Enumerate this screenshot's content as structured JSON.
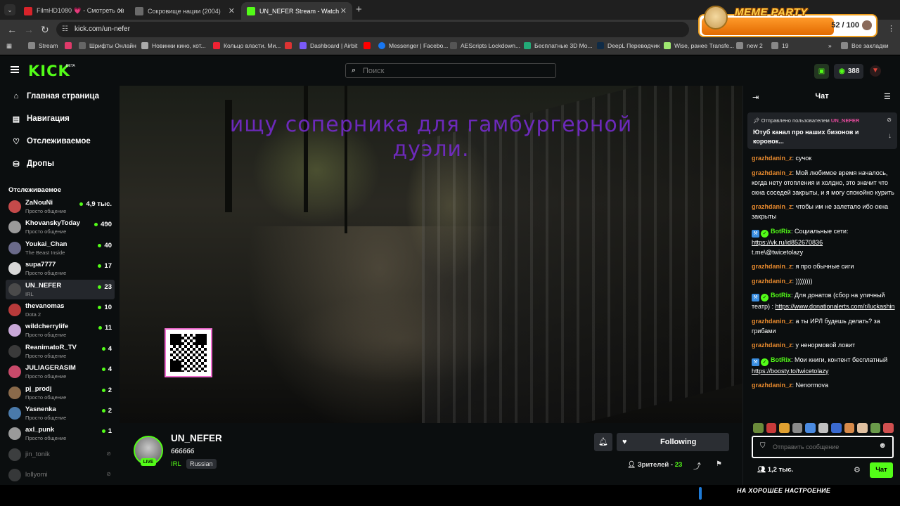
{
  "browser": {
    "tabs": [
      {
        "title": "FilmHD1080 💗 - Смотреть он",
        "favicon_color": "#d8232a",
        "active": false
      },
      {
        "title": "Сокровище нации (2004)",
        "favicon_color": "#6a6a6a",
        "active": false
      },
      {
        "title": "UN_NEFER Stream - Watch",
        "favicon_color": "#53fc18",
        "active": true
      }
    ],
    "url": "kick.com/un-nefer",
    "bookmarks": [
      {
        "label": "Stream",
        "icon_color": "#888"
      },
      {
        "label": "",
        "icon_color": "#e03a6a"
      },
      {
        "label": "Шрифты Онлайн",
        "icon_color": "#666"
      },
      {
        "label": "Новинки кино, кот...",
        "icon_color": "#aaa"
      },
      {
        "label": "Кольцо власти. Ми...",
        "icon_color": "#e23"
      },
      {
        "label": "",
        "icon_color": "#d33"
      },
      {
        "label": "Dashboard | Airbit",
        "icon_color": "#7a5af8"
      },
      {
        "label": "",
        "icon_color": "#f00"
      },
      {
        "label": "Messenger | Facebo...",
        "icon_color": "#1877f2"
      },
      {
        "label": "AEScripts Lockdown...",
        "icon_color": "#555"
      },
      {
        "label": "Бесплатные 3D Mo...",
        "icon_color": "#2a7"
      },
      {
        "label": "DeepL Переводчик",
        "icon_color": "#0f2b46"
      },
      {
        "label": "Wise, ранее Transfe...",
        "icon_color": "#9fe870"
      },
      {
        "label": "new 2",
        "icon_color": "#888"
      },
      {
        "label": "19",
        "icon_color": "#888"
      }
    ],
    "all_bookmarks": "Все закладки"
  },
  "meme_party": {
    "title": "MEME PARTY",
    "progress": "52 / 100",
    "progress_value": 52,
    "progress_max": 100
  },
  "header": {
    "logo": "KICK",
    "logo_badge": "BETA",
    "search_placeholder": "Поиск",
    "kicks_balance": "388"
  },
  "nav": [
    {
      "label": "Главная страница",
      "icon": "home-icon"
    },
    {
      "label": "Навигация",
      "icon": "browse-icon"
    },
    {
      "label": "Отслеживаемое",
      "icon": "heart-icon"
    },
    {
      "label": "Дропы",
      "icon": "drops-icon"
    }
  ],
  "following": {
    "title": "Отслеживаемое",
    "channels": [
      {
        "name": "ZaNouNi",
        "category": "Просто общение",
        "viewers": "4,9 тыс.",
        "color": "#c44a4a"
      },
      {
        "name": "KhovanskyToday",
        "category": "Просто общение",
        "viewers": "490",
        "color": "#9a9a9a"
      },
      {
        "name": "Youkai_Chan",
        "category": "The Beast Inside",
        "viewers": "40",
        "color": "#6a6a8a"
      },
      {
        "name": "supa7777",
        "category": "Просто общение",
        "viewers": "17",
        "color": "#d8d8d8"
      },
      {
        "name": "UN_NEFER",
        "category": "IRL",
        "viewers": "23",
        "color": "#4a4a4a",
        "selected": true
      },
      {
        "name": "thevanomas",
        "category": "Dota 2",
        "viewers": "10",
        "color": "#b83a3a"
      },
      {
        "name": "wildcherrylife",
        "category": "Просто общение",
        "viewers": "11",
        "color": "#c8a8d8"
      },
      {
        "name": "ReanimatoR_TV",
        "category": "Просто общение",
        "viewers": "4",
        "color": "#3a3a3a"
      },
      {
        "name": "JULIAGERASIM",
        "category": "Просто общение",
        "viewers": "4",
        "color": "#c84a6a"
      },
      {
        "name": "pj_prodj",
        "category": "Просто общение",
        "viewers": "2",
        "color": "#8a6a4a"
      },
      {
        "name": "Yasnenka",
        "category": "Просто общение",
        "viewers": "2",
        "color": "#4a7aaa"
      },
      {
        "name": "axl_punk",
        "category": "Просто общение",
        "viewers": "1",
        "color": "#9a9a9a"
      }
    ],
    "offline": [
      {
        "name": "jin_tonik",
        "color": "#888"
      },
      {
        "name": "lollyomi",
        "color": "#777"
      }
    ]
  },
  "video": {
    "overlay_text": "ищу соперника для гамбургерной дуэли."
  },
  "channel": {
    "name": "UN_NEFER",
    "stream_title": "бббббб",
    "live": "LIVE",
    "category": "IRL",
    "language": "Russian",
    "follow_label": "Following",
    "viewers_label": "Зрителей - ",
    "viewers_count": "23"
  },
  "chat": {
    "title": "Чат",
    "pinned": {
      "by_label": "Отправлено пользователем",
      "user": "UN_NEFER",
      "text": "Ютуб канал про наших бизонов и коровок..."
    },
    "messages": [
      {
        "user": "grazhdanin_z",
        "text": "сучок"
      },
      {
        "user": "grazhdanin_z",
        "text": "Мой любимое время началось, когда нету отопления и холдно, это значит что окна соседей закрыты, и я могу спокойно курить"
      },
      {
        "user": "grazhdanin_z",
        "text": "чтобы им не залетало ибо окна закрыты"
      },
      {
        "user": "BotRix",
        "bot": true,
        "text": "Социальные сети:",
        "links": [
          "https://vk.ru/id852670836"
        ],
        "tail": "t.me\\@twicetolazy"
      },
      {
        "user": "grazhdanin_z",
        "text": "я про обычные сиги"
      },
      {
        "user": "grazhdanin_z",
        "text": "))))))))"
      },
      {
        "user": "BotRix",
        "bot": true,
        "text": "Для донатов (сбор на уличный театр) :",
        "links": [
          "https://www.donationalerts.com/r/luckashin"
        ]
      },
      {
        "user": "grazhdanin_z",
        "text": "а ты ИРЛ будешь делать? за грибами"
      },
      {
        "user": "grazhdanin_z",
        "text": "у ненормовой ловит"
      },
      {
        "user": "BotRix",
        "bot": true,
        "text": "Мои книги, контент бесплатный",
        "links": [
          "https://boosty.to/twicetolazy"
        ]
      },
      {
        "user": "grazhdanin_z",
        "text": "Nenormova"
      }
    ],
    "input_placeholder": "Отправить сообщение",
    "kicks_count": "1,2 тыс.",
    "send_label": "Чат",
    "emote_colors": [
      "#6a8a3a",
      "#c83a3a",
      "#e0a030",
      "#8a8a8a",
      "#4a8ae0",
      "#c0c0c0",
      "#3a6ad0",
      "#d88a4a",
      "#e0c0a0",
      "#6a9a4a",
      "#d05050"
    ]
  },
  "bottom_overlay_text": "НА ХОРОШЕЕ НАСТРОЕНИЕ"
}
